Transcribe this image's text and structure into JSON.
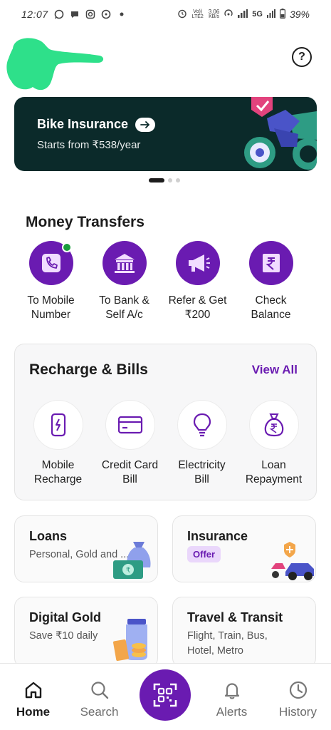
{
  "status_bar": {
    "time": "12:07",
    "network_label": "Vo)) LTE2",
    "speed": "3.06",
    "speed_unit": "KB/s",
    "network_type": "5G",
    "battery": "39%"
  },
  "header": {
    "help_label": "?"
  },
  "banner": {
    "title": "Bike Insurance",
    "subtitle": "Starts from ₹538/year"
  },
  "money_transfers": {
    "title": "Money Transfers",
    "items": [
      {
        "line1": "To Mobile",
        "line2": "Number",
        "icon": "phone-icon"
      },
      {
        "line1": "To Bank &",
        "line2": "Self A/c",
        "icon": "bank-icon"
      },
      {
        "line1": "Refer & Get",
        "line2": "₹200",
        "icon": "megaphone-icon"
      },
      {
        "line1": "Check",
        "line2": "Balance",
        "icon": "rupee-book-icon"
      }
    ]
  },
  "recharge_bills": {
    "title": "Recharge & Bills",
    "view_all": "View All",
    "items": [
      {
        "line1": "Mobile",
        "line2": "Recharge",
        "icon": "mobile-charge-icon"
      },
      {
        "line1": "Credit Card",
        "line2": "Bill",
        "icon": "credit-card-icon"
      },
      {
        "line1": "Electricity",
        "line2": "Bill",
        "icon": "bulb-icon"
      },
      {
        "line1": "Loan",
        "line2": "Repayment",
        "icon": "money-bag-icon"
      }
    ]
  },
  "tiles": {
    "loans": {
      "title": "Loans",
      "subtitle": "Personal, Gold and ..."
    },
    "insurance": {
      "title": "Insurance",
      "badge": "Offer"
    },
    "gold": {
      "title": "Digital Gold",
      "subtitle": "Save ₹10 daily"
    },
    "travel": {
      "title": "Travel & Transit",
      "subtitle_line1": "Flight, Train, Bus,",
      "subtitle_line2": "Hotel, Metro"
    }
  },
  "bottom_nav": {
    "home": "Home",
    "search": "Search",
    "alerts": "Alerts",
    "history": "History"
  },
  "colors": {
    "brand_purple": "#6a1bb1",
    "banner_bg": "#0b2a2a",
    "online_green": "#1a9d3c"
  }
}
